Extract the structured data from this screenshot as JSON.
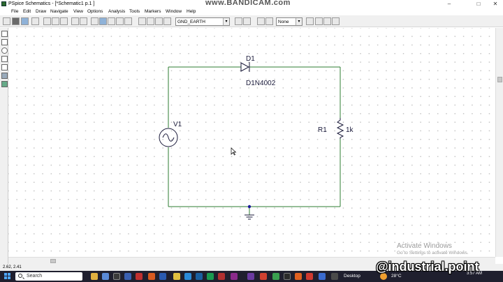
{
  "window": {
    "title": "PSpice Schematics - [*Schematic1  p.1  ]",
    "watermark": "www.BANDICAM.com",
    "minimize": "–",
    "maximize": "□",
    "close": "✕"
  },
  "menu": [
    "File",
    "Edit",
    "Draw",
    "Navigate",
    "View",
    "Options",
    "Analysis",
    "Tools",
    "Markers",
    "Window",
    "Help"
  ],
  "toolbar": {
    "part_select": "GND_EARTH",
    "probe_select": "None"
  },
  "schematic": {
    "diode": {
      "ref": "D1",
      "model": "D1N4002"
    },
    "source": {
      "ref": "V1"
    },
    "resistor": {
      "ref": "R1",
      "value": "1k"
    }
  },
  "status": {
    "coords": "2.62, 2.41"
  },
  "overlay": {
    "activate_title": "Activate Windows",
    "activate_sub": "Go to Settings to activate Windows.",
    "channel": "@industrial.point"
  },
  "taskbar": {
    "search_label": "Search",
    "desktop_label": "Desktop",
    "temperature": "28°C",
    "time": "3:57 AM"
  },
  "colors": {
    "wire": "#2e7d32",
    "node": "#1a1a9a",
    "taskbar": "#1f1f2e"
  }
}
